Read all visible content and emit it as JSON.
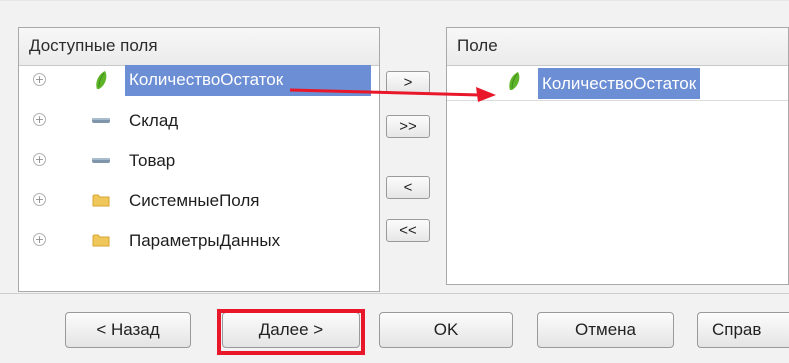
{
  "left_panel": {
    "header": "Доступные поля",
    "items": [
      {
        "label": "КоличествоОстаток",
        "icon": "green-resource-icon",
        "selected": true
      },
      {
        "label": "Склад",
        "icon": "dimension-icon"
      },
      {
        "label": "Товар",
        "icon": "dimension-icon"
      },
      {
        "label": "СистемныеПоля",
        "icon": "folder-icon"
      },
      {
        "label": "ПараметрыДанных",
        "icon": "folder-icon"
      }
    ],
    "expander_glyph": "+"
  },
  "middle_buttons": {
    "add": ">",
    "add_all": ">>",
    "remove": "<",
    "remove_all": "<<"
  },
  "right_panel": {
    "header": "Поле",
    "items": [
      {
        "label": "КоличествоОстаток",
        "icon": "green-resource-icon",
        "selected": true
      }
    ]
  },
  "footer": {
    "back": "< Назад",
    "next": "Далее >",
    "ok": "OK",
    "cancel": "Отмена",
    "help": "Справ"
  },
  "colors": {
    "selection": "#6c8ed4",
    "annotation_red": "#e8182a",
    "resource_green": "#5fb52a"
  }
}
